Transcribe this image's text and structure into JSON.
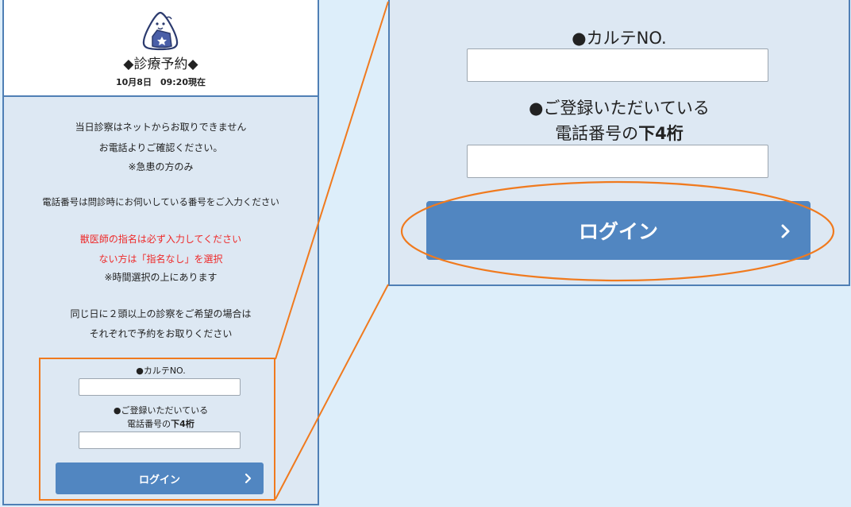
{
  "header": {
    "title": "◆診療予約◆",
    "updated": "10月8日　09:20現在"
  },
  "notices": {
    "line1": "当日診察はネットからお取りできません",
    "line2": "お電話よりご確認ください。",
    "line3": "※急患の方のみ",
    "line4": "電話番号は問診時にお伺いしている番号をご入力ください",
    "red1": "獣医師の指名は必ず入力してください",
    "red2": "ない方は「指名なし」を選択",
    "line5": "※時間選択の上にあります",
    "line6": "同じ日に２頭以上の診察をご希望の場合は",
    "line7": "それぞれで予約をお取りください"
  },
  "form": {
    "chart_label": "●カルテNO.",
    "phone_label_1": "●ご登録いただいている",
    "phone_label_2_prefix": "電話番号の",
    "phone_label_2_bold": "下4桁",
    "chart_value": "",
    "phone_value": "",
    "login_label": "ログイン"
  },
  "colors": {
    "accent": "#5186c1",
    "highlight": "#f07a1e",
    "alert": "#ee2a2a",
    "panel_bg": "#dde8f3",
    "page_bg": "#ddeefa"
  },
  "icons": {
    "logo": "rice-ball-mascot-icon",
    "login_arrow": "chevron-right-icon"
  }
}
